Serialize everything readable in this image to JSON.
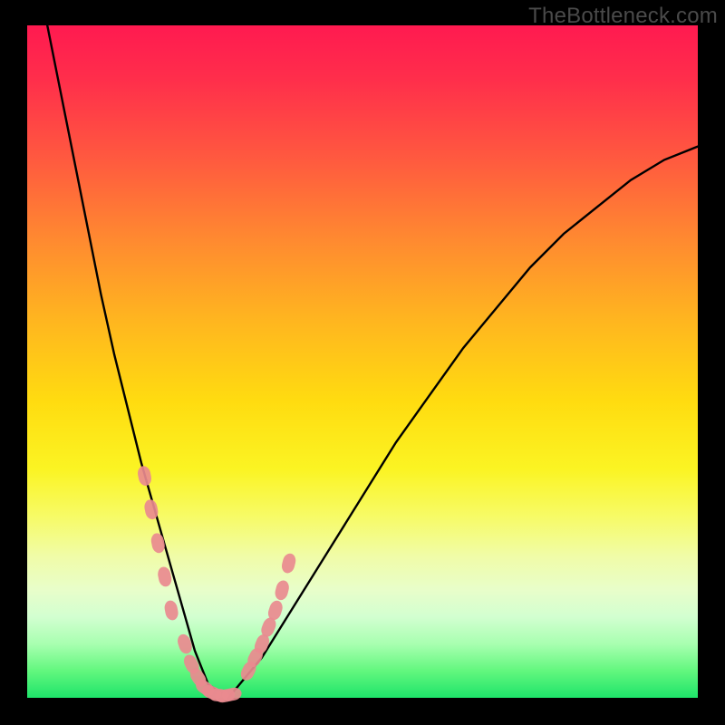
{
  "watermark": "TheBottleneck.com",
  "chart_data": {
    "type": "line",
    "title": "",
    "xlabel": "",
    "ylabel": "",
    "xlim": [
      0,
      100
    ],
    "ylim": [
      0,
      100
    ],
    "grid": false,
    "legend": false,
    "series": [
      {
        "name": "bottleneck-curve",
        "x": [
          3,
          5,
          7,
          9,
          11,
          13,
          15,
          17,
          19,
          21,
          23,
          25,
          27,
          30,
          35,
          40,
          45,
          50,
          55,
          60,
          65,
          70,
          75,
          80,
          85,
          90,
          95,
          100
        ],
        "y": [
          100,
          90,
          80,
          70,
          60,
          51,
          43,
          35,
          28,
          21,
          14,
          7,
          2,
          0,
          6,
          14,
          22,
          30,
          38,
          45,
          52,
          58,
          64,
          69,
          73,
          77,
          80,
          82
        ]
      }
    ],
    "markers": {
      "name": "highlight-points",
      "color": "#e98a8f",
      "segments": [
        {
          "x": [
            17.5,
            18.5,
            19.5,
            20.5,
            21.5
          ],
          "y": [
            33,
            28,
            23,
            18,
            13
          ]
        },
        {
          "x": [
            23.5,
            24.5,
            25.5,
            26.5,
            27.5,
            28.5,
            29.5,
            30.5
          ],
          "y": [
            8,
            5,
            3,
            1.5,
            0.8,
            0.4,
            0.3,
            0.5
          ]
        },
        {
          "x": [
            33.0,
            34.0,
            35.0,
            36.0,
            37.0,
            38.0,
            39.0
          ],
          "y": [
            4,
            6,
            8,
            10.5,
            13,
            16,
            20
          ]
        }
      ]
    },
    "gradient_stops": [
      {
        "pos": 0.0,
        "color": "#ff1a50"
      },
      {
        "pos": 0.5,
        "color": "#ffd400"
      },
      {
        "pos": 0.8,
        "color": "#f0fca8"
      },
      {
        "pos": 1.0,
        "color": "#1ee46a"
      }
    ]
  }
}
